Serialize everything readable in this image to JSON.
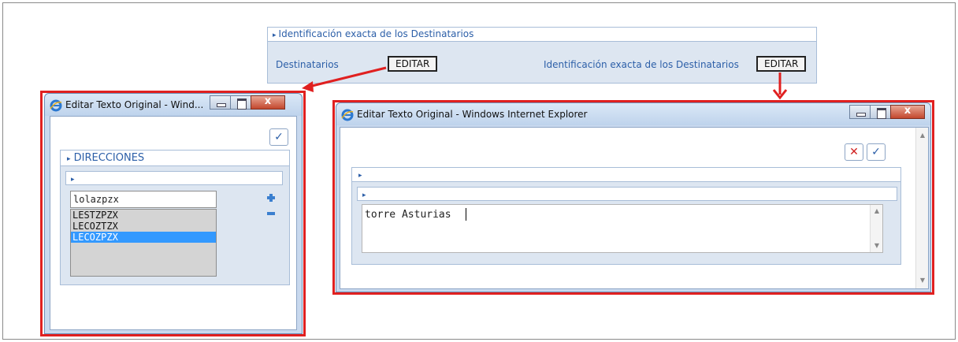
{
  "top_form": {
    "header": "Identificación exacta de los Destinatarios",
    "field1_label": "Destinatarios",
    "field1_button": "EDITAR",
    "field2_label": "Identificación exacta de los Destinatarios",
    "field2_button": "EDITAR"
  },
  "left_window": {
    "title": "Editar Texto Original - Wind...",
    "section": "DIRECCIONES",
    "input_value": "lolazpzx",
    "list_items": [
      "LESTZPZX",
      "LECOZTZX",
      "LECOZPZX"
    ],
    "selected_index": 2,
    "add_icon": "plus-icon",
    "remove_icon": "minus-icon"
  },
  "right_window": {
    "title": "Editar Texto Original - Windows Internet Explorer",
    "text_value": "torre Asturias"
  },
  "colors": {
    "highlight": "#e02020",
    "accent": "#2c5fa8",
    "selection": "#3399ff"
  }
}
